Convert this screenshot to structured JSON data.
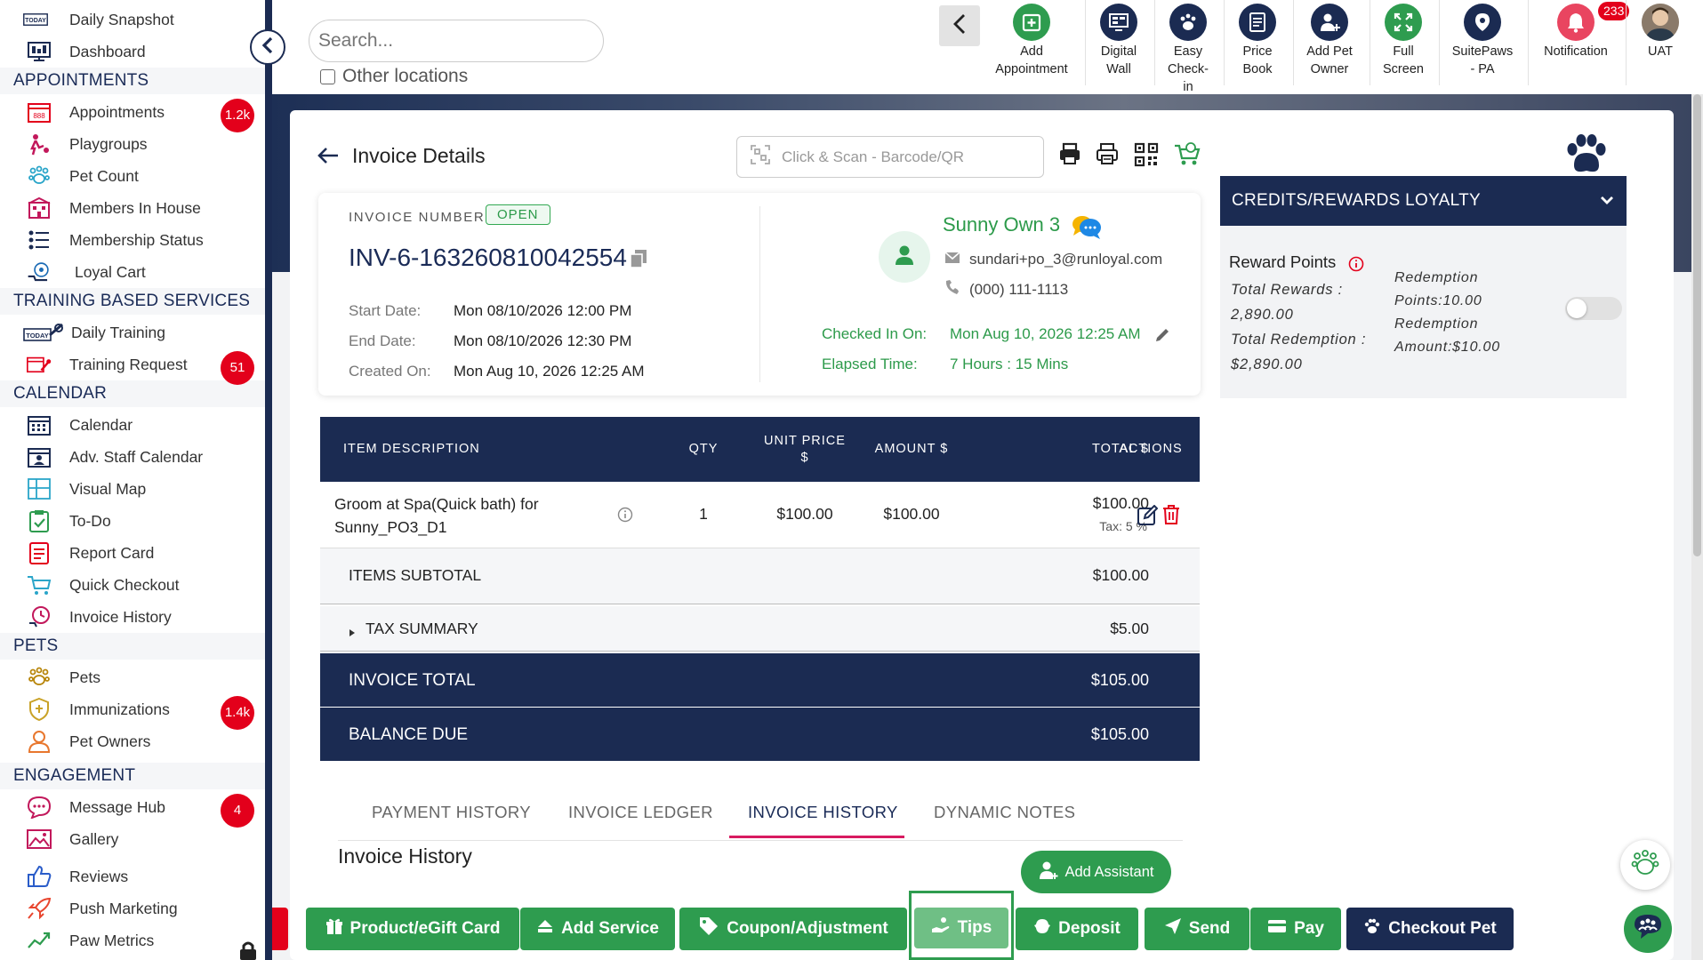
{
  "sidebar": {
    "top_items": [
      {
        "label": "Daily Snapshot",
        "icon": "today-icon"
      },
      {
        "label": "Dashboard",
        "icon": "dashboard-icon"
      }
    ],
    "sections": [
      {
        "title": "APPOINTMENTS",
        "items": [
          {
            "label": "Appointments",
            "icon": "calendar-grid-icon",
            "badge": "1.2k"
          },
          {
            "label": "Playgroups",
            "icon": "playgroup-icon"
          },
          {
            "label": "Pet Count",
            "icon": "paw-count-icon"
          },
          {
            "label": "Members In House",
            "icon": "house-icon"
          },
          {
            "label": "Membership Status",
            "icon": "membership-list-icon"
          },
          {
            "label": "Loyal Cart",
            "icon": "loyal-cart-icon"
          }
        ]
      },
      {
        "title": "TRAINING BASED SERVICES",
        "items": [
          {
            "label": "Daily Training",
            "icon": "today-training-icon"
          },
          {
            "label": "Training Request",
            "icon": "training-request-icon",
            "badge": "51"
          }
        ]
      },
      {
        "title": "CALENDAR",
        "items": [
          {
            "label": "Calendar",
            "icon": "calendar-icon"
          },
          {
            "label": "Adv. Staff Calendar",
            "icon": "staff-calendar-icon"
          },
          {
            "label": "Visual Map",
            "icon": "visual-map-icon"
          },
          {
            "label": "To-Do",
            "icon": "todo-icon"
          },
          {
            "label": "Report Card",
            "icon": "report-card-icon"
          },
          {
            "label": "Quick Checkout",
            "icon": "cart-icon"
          },
          {
            "label": "Invoice History",
            "icon": "invoice-history-icon"
          }
        ]
      },
      {
        "title": "PETS",
        "items": [
          {
            "label": "Pets",
            "icon": "paw-icon"
          },
          {
            "label": "Immunizations",
            "icon": "shield-icon",
            "badge": "1.4k"
          },
          {
            "label": "Pet Owners",
            "icon": "person-icon"
          }
        ]
      },
      {
        "title": "ENGAGEMENT",
        "items": [
          {
            "label": "Message Hub",
            "icon": "chat-icon",
            "badge": "4"
          },
          {
            "label": "Gallery",
            "icon": "gallery-icon"
          },
          {
            "label": "Reviews",
            "icon": "thumbs-up-icon"
          },
          {
            "label": "Push Marketing",
            "icon": "rocket-icon"
          },
          {
            "label": "Paw Metrics",
            "icon": "metrics-icon"
          }
        ]
      }
    ]
  },
  "topbar": {
    "search_placeholder": "Search...",
    "other_locations": "Other locations",
    "items": [
      {
        "label": "Add\nAppointment",
        "icon": "add-appointment-icon",
        "color": "#2e9c4f"
      },
      {
        "label": "Digital\nWall",
        "icon": "digital-wall-icon",
        "color": "#1b2b52"
      },
      {
        "label": "Easy\nCheck-\nin",
        "icon": "easy-checkin-icon",
        "color": "#1b2b52"
      },
      {
        "label": "Price\nBook",
        "icon": "price-book-icon",
        "color": "#1b2b52"
      },
      {
        "label": "Add Pet\nOwner",
        "icon": "add-owner-icon",
        "color": "#1b2b52"
      },
      {
        "label": "Full\nScreen",
        "icon": "fullscreen-icon",
        "color": "#2e9c4f"
      },
      {
        "label": "SuitePaws\n- PA",
        "icon": "suitepaws-icon",
        "color": "#1b2b52"
      },
      {
        "label": "Notification",
        "icon": "bell-icon",
        "color": "#e3001b",
        "badge": "233"
      },
      {
        "label": "UAT",
        "icon": "user-avatar-icon"
      }
    ]
  },
  "invoice": {
    "title": "Invoice Details",
    "scan_placeholder": "Click & Scan - Barcode/QR",
    "number_label": "INVOICE NUMBER",
    "status": "OPEN",
    "number": "INV-6-163260810042554",
    "start_label": "Start Date:",
    "start_value": "Mon 08/10/2026 12:00 PM",
    "end_label": "End Date:",
    "end_value": "Mon 08/10/2026 12:30 PM",
    "created_label": "Created On:",
    "created_value": "Mon Aug 10, 2026 12:25 AM",
    "customer": {
      "name": "Sunny Own 3",
      "email": "sundari+po_3@runloyal.com",
      "phone": "(000) 111-1113",
      "checked_in_label": "Checked In On:",
      "checked_in_value": "Mon Aug 10, 2026 12:25 AM",
      "elapsed_label": "Elapsed Time:",
      "elapsed_value": "7 Hours : 15 Mins"
    },
    "table": {
      "headers": {
        "description": "ITEM DESCRIPTION",
        "qty": "QTY",
        "unit_price": "UNIT PRICE\n$",
        "amount": "AMOUNT $",
        "total": "TOTAL $",
        "actions": "ACTIONS"
      },
      "rows": [
        {
          "description": "Groom at Spa(Quick bath) for\nSunny_PO3_D1",
          "qty": "1",
          "unit_price": "$100.00",
          "amount": "$100.00",
          "total": "$100.00",
          "tax": "Tax: 5 %"
        }
      ],
      "subtotal_label": "ITEMS SUBTOTAL",
      "subtotal_value": "$100.00",
      "tax_label": "TAX SUMMARY",
      "tax_value": "$5.00",
      "total_label": "INVOICE TOTAL",
      "total_value": "$105.00",
      "balance_label": "BALANCE DUE",
      "balance_value": "$105.00"
    },
    "tabs": [
      "PAYMENT HISTORY",
      "INVOICE LEDGER",
      "INVOICE HISTORY",
      "DYNAMIC NOTES"
    ],
    "active_tab": "INVOICE HISTORY",
    "history_title": "Invoice History",
    "add_assistant": "Add Assistant"
  },
  "credits": {
    "title": "CREDITS/REWARDS LOYALTY",
    "reward_points": "Reward Points",
    "total_rewards_label": "Total Rewards :",
    "total_rewards_value": "2,890.00",
    "total_redemption_label": "Total Redemption :",
    "total_redemption_value": "$2,890.00",
    "redemption_points_label": "Redemption",
    "redemption_points_value": "Points:10.00",
    "redemption_amount_label": "Redemption",
    "redemption_amount_value": "Amount:$10.00"
  },
  "bottom_actions": [
    {
      "label": "Product/eGift Card",
      "icon": "gift-icon"
    },
    {
      "label": "Add Service",
      "icon": "add-service-icon"
    },
    {
      "label": "Coupon/Adjustment",
      "icon": "tag-icon"
    },
    {
      "label": "Tips",
      "icon": "tips-icon"
    },
    {
      "label": "Deposit",
      "icon": "deposit-icon"
    },
    {
      "label": "Send",
      "icon": "send-icon"
    },
    {
      "label": "Pay",
      "icon": "card-icon"
    },
    {
      "label": "Checkout Pet",
      "icon": "paw-icon"
    }
  ],
  "colors": {
    "navy": "#1b2b52",
    "green": "#2e9c4f",
    "red": "#e3001b",
    "pink": "#d81b60"
  }
}
